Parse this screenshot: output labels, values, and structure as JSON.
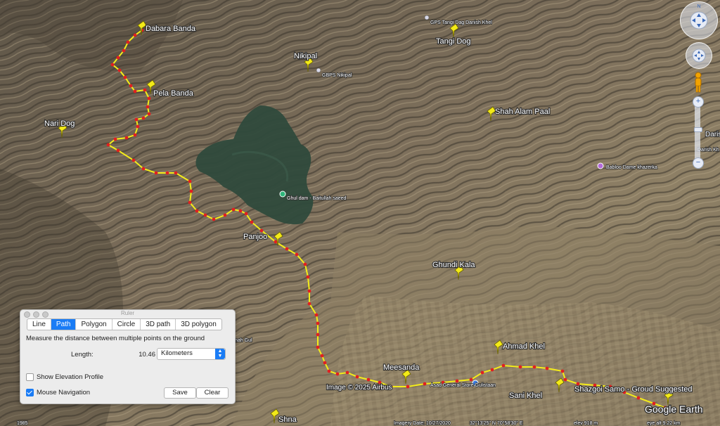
{
  "ruler": {
    "title": "Ruler",
    "tabs": [
      "Line",
      "Path",
      "Polygon",
      "Circle",
      "3D path",
      "3D polygon"
    ],
    "active_tab": "Path",
    "description": "Measure the distance between multiple points on the ground",
    "length_label": "Length:",
    "length_value": "10.46",
    "units": "Kilometers",
    "show_elevation_label": "Show Elevation Profile",
    "show_elevation_checked": false,
    "mouse_nav_label": "Mouse Navigation",
    "mouse_nav_checked": true,
    "save_label": "Save",
    "clear_label": "Clear"
  },
  "places": [
    {
      "id": "dabara",
      "label": "Dabara Banda"
    },
    {
      "id": "pela",
      "label": "Pela Banda"
    },
    {
      "id": "nari",
      "label": "Nari Dog"
    },
    {
      "id": "nikipal",
      "label": "Nikipal"
    },
    {
      "id": "tangi",
      "label": "Tangi Dog"
    },
    {
      "id": "shah",
      "label": "Shah Alam Paal"
    },
    {
      "id": "panjoo",
      "label": "Panjoo"
    },
    {
      "id": "ghundi",
      "label": "Ghundi Kala"
    },
    {
      "id": "ahmad",
      "label": "Ahmad Khel"
    },
    {
      "id": "meesanda",
      "label": "Meesanda"
    },
    {
      "id": "sani",
      "label": "Sani Khel"
    },
    {
      "id": "shazgoi",
      "label": "Shazgoi Samo - Groud Suggested"
    },
    {
      "id": "shna",
      "label": "Shna"
    }
  ],
  "pois": {
    "ghul_dam": "Ghul dam - Baitullah saeed",
    "gps_tangi": "GPS Tangi Dag Danish Khel",
    "gbps_nikipal": "GBPS Nikipal",
    "babloo": "Babloo Dame khazerka",
    "asad_store": "Asad General Store Gulistaan",
    "daris": "Daris",
    "darish_kh": "Darish Kh",
    "shah_gul": "nah Gul"
  },
  "map_footer": {
    "attribution": "Image © 2025 Airbus",
    "logo": "Google Earth",
    "imagery_date": "Imagery Date: 10/27/2020",
    "coords": "32°13'25\" N 70°58'30\" E",
    "elev": "elev 918 m",
    "eye": "eye alt 9.22 km",
    "left_val": "1985"
  },
  "colors": {
    "path": "#f4ec1a",
    "path_point": "#e02020",
    "tab_active": "#1a7cf5",
    "water": "#2f4a3c"
  }
}
